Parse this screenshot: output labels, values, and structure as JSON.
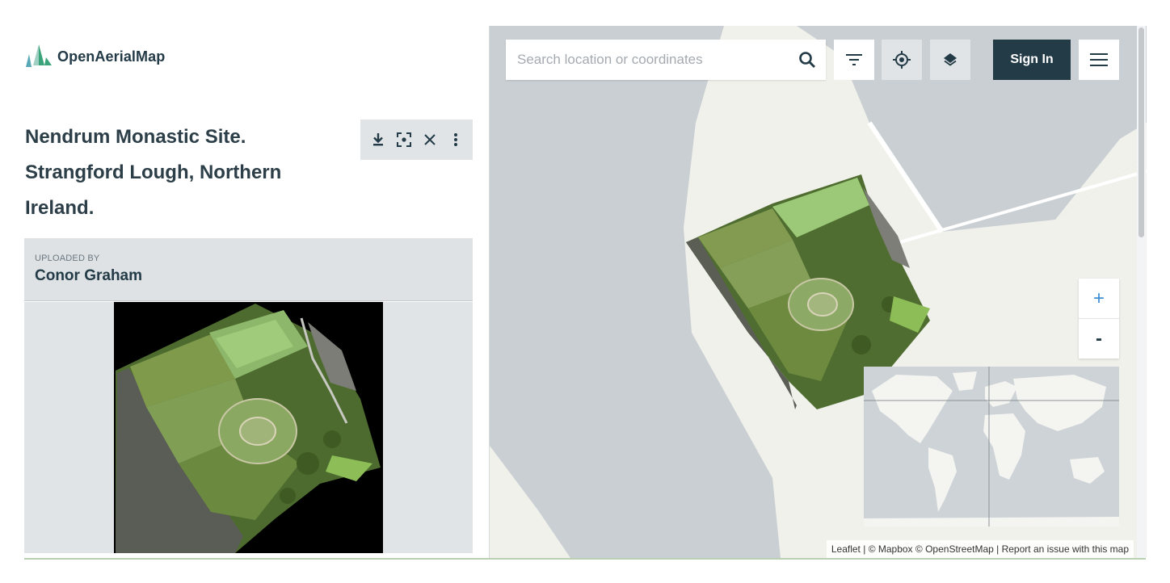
{
  "brand": {
    "name": "OpenAerialMap"
  },
  "image": {
    "title": "Nendrum Monastic Site. Strangford Lough, Northern Ireland.",
    "uploaded_by_label": "UPLOADED BY",
    "uploader": "Conor Graham"
  },
  "actions": {
    "icons": [
      "download-icon",
      "focus-icon",
      "close-icon",
      "more-vertical-icon"
    ]
  },
  "search": {
    "placeholder": "Search location or coordinates",
    "value": ""
  },
  "toolbar": {
    "icons": [
      "filter-icon",
      "locate-icon",
      "layers-icon",
      "hamburger-menu-icon"
    ],
    "sign_in_label": "Sign In"
  },
  "zoom": {
    "in_label": "+",
    "out_label": "-"
  },
  "attribution": {
    "leaflet": "Leaflet",
    "sep1": " | ",
    "mapbox": "© Mapbox",
    "osm": "© OpenStreetMap",
    "sep2": " | ",
    "report": "Report an issue with this map"
  },
  "colors": {
    "primary": "#233a47",
    "accent_blue": "#3d8ed4",
    "water": "#c9cfd2",
    "land": "#f1f1ec",
    "panel_gray": "#e1e4e6"
  }
}
